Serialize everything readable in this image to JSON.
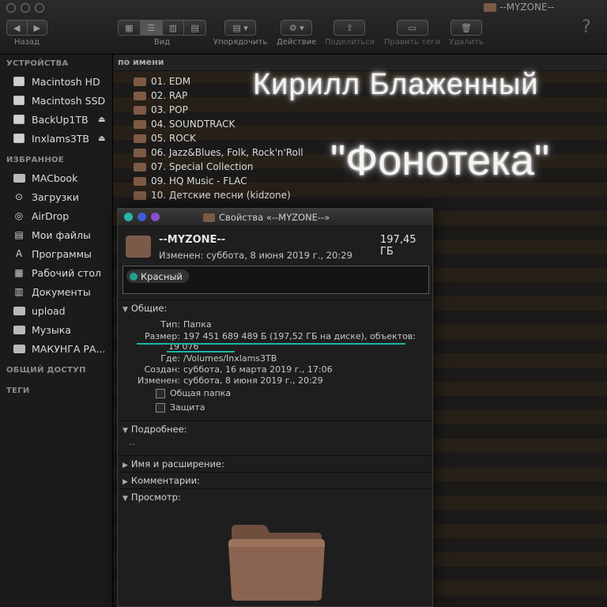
{
  "window": {
    "title": "--MYZONE--"
  },
  "toolbar": {
    "back_label": "Назад",
    "view_label": "Вид",
    "arrange_label": "Упорядочить",
    "action_label": "Действие",
    "share_label": "Поделиться",
    "tags_label": "Править теги",
    "delete_label": "Удалить",
    "help_symbol": "?"
  },
  "sidebar": {
    "devices_title": "УСТРОЙСТВА",
    "devices": [
      {
        "label": "Macintosh HD",
        "icon": "disk-icon"
      },
      {
        "label": "Macintosh SSD",
        "icon": "disk-icon"
      },
      {
        "label": "BackUp1TB",
        "icon": "disk-icon",
        "eject": true
      },
      {
        "label": "Inxlams3TB",
        "icon": "disk-icon",
        "eject": true
      }
    ],
    "favorites_title": "ИЗБРАННОЕ",
    "favorites": [
      {
        "label": "MACbook",
        "icon": "folder-icon"
      },
      {
        "label": "Загрузки",
        "icon": "download-icon"
      },
      {
        "label": "AirDrop",
        "icon": "airdrop-icon"
      },
      {
        "label": "Мои файлы",
        "icon": "files-icon"
      },
      {
        "label": "Программы",
        "icon": "apps-icon"
      },
      {
        "label": "Рабочий стол",
        "icon": "desktop-icon"
      },
      {
        "label": "Документы",
        "icon": "documents-icon"
      },
      {
        "label": "upload",
        "icon": "folder-icon"
      },
      {
        "label": "Музыка",
        "icon": "music-icon"
      },
      {
        "label": "МАКУНГА РА...",
        "icon": "folder-icon"
      }
    ],
    "shared_title": "ОБЩИЙ ДОСТУП",
    "tags_title": "ТЕГИ"
  },
  "list": {
    "column_header": "по имени",
    "items": [
      "01. EDM",
      "02. RAP",
      "03. POP",
      "04. SOUNDTRACK",
      "05. ROCK",
      "06. Jazz&Blues, Folk, Rock'n'Roll",
      "07. Special Collection",
      "09. HQ Music - FLAC",
      "10. Детские песни (kidzone)"
    ]
  },
  "overlay": {
    "headline": "Кирилл Блаженный",
    "subline": "\"Фонотека\""
  },
  "info": {
    "title": "Свойства «--MYZONE--»",
    "name": "--MYZONE--",
    "size": "197,45 ГБ",
    "modified_line": "Изменен: суббота, 8 июня 2019 г., 20:29",
    "tag": "Красный",
    "tag_color": "#27a093",
    "general": {
      "title": "Общие:",
      "type_key": "Тип:",
      "type_val": "Папка",
      "size_key": "Размер:",
      "size_val": "197 451 689 489 Б (197,52 ГБ на диске), объектов:",
      "size_val2": "19 076",
      "where_key": "Где:",
      "where_val": "/Volumes/Inxlams3TB",
      "created_key": "Создан:",
      "created_val": "суббота, 16 марта 2019 г., 17:06",
      "modified_key": "Изменен:",
      "modified_val": "суббота, 8 июня 2019 г., 20:29",
      "shared_folder": "Общая папка",
      "locked": "Защита"
    },
    "more": {
      "title": "Подробнее:",
      "value": "--"
    },
    "name_ext": "Имя и расширение:",
    "comments": "Комментарии:",
    "preview": "Просмотр:"
  }
}
